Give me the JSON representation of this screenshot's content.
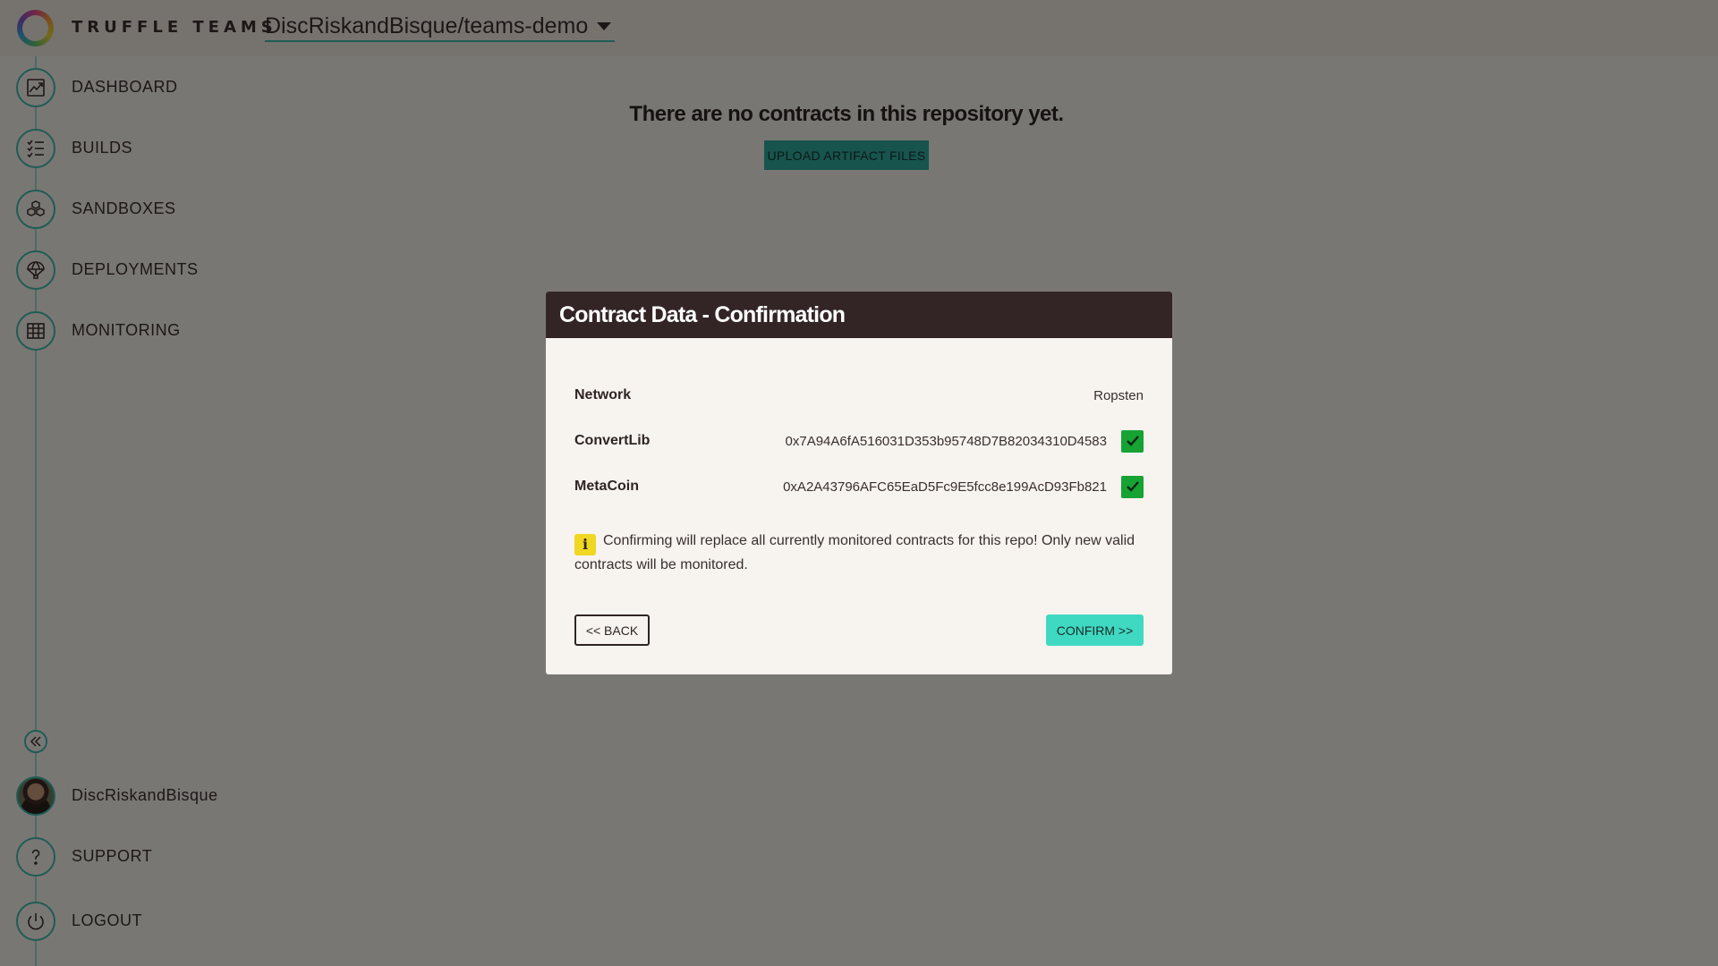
{
  "header": {
    "brand": "TRUFFLE TEAMS",
    "repo": "DiscRiskandBisque/teams-demo"
  },
  "sidebar": {
    "items": [
      {
        "label": "DASHBOARD",
        "icon": "chart-line-icon"
      },
      {
        "label": "BUILDS",
        "icon": "list-checks-icon"
      },
      {
        "label": "SANDBOXES",
        "icon": "cubes-icon"
      },
      {
        "label": "DEPLOYMENTS",
        "icon": "parachute-icon"
      },
      {
        "label": "MONITORING",
        "icon": "table-grid-icon"
      }
    ],
    "bottom": [
      {
        "label": "DiscRiskandBisque",
        "icon": "avatar"
      },
      {
        "label": "SUPPORT",
        "icon": "question-icon"
      },
      {
        "label": "LOGOUT",
        "icon": "power-icon"
      }
    ]
  },
  "main": {
    "empty_message": "There are no contracts in this repository yet.",
    "upload_label": "UPLOAD ARTIFACT FILES"
  },
  "modal": {
    "title": "Contract Data - Confirmation",
    "rows": [
      {
        "label": "Network",
        "value": "Ropsten"
      },
      {
        "label": "ConvertLib",
        "value": "0x7A94A6fA516031D353b95748D7B82034310D4583",
        "checked": true
      },
      {
        "label": "MetaCoin",
        "value": "0xA2A43796AFC65EaD5Fc9E5fcc8e199AcD93Fb821",
        "checked": true
      }
    ],
    "notice": "Confirming will replace all currently monitored contracts for this repo! Only new valid contracts will be monitored.",
    "info_glyph": "i",
    "back_label": "<< BACK",
    "confirm_label": "CONFIRM >>"
  },
  "colors": {
    "accent": "#3fb8a8",
    "header_dark": "#332426",
    "confirm": "#3fd9c2",
    "check": "#16a334",
    "info": "#f0d722"
  }
}
